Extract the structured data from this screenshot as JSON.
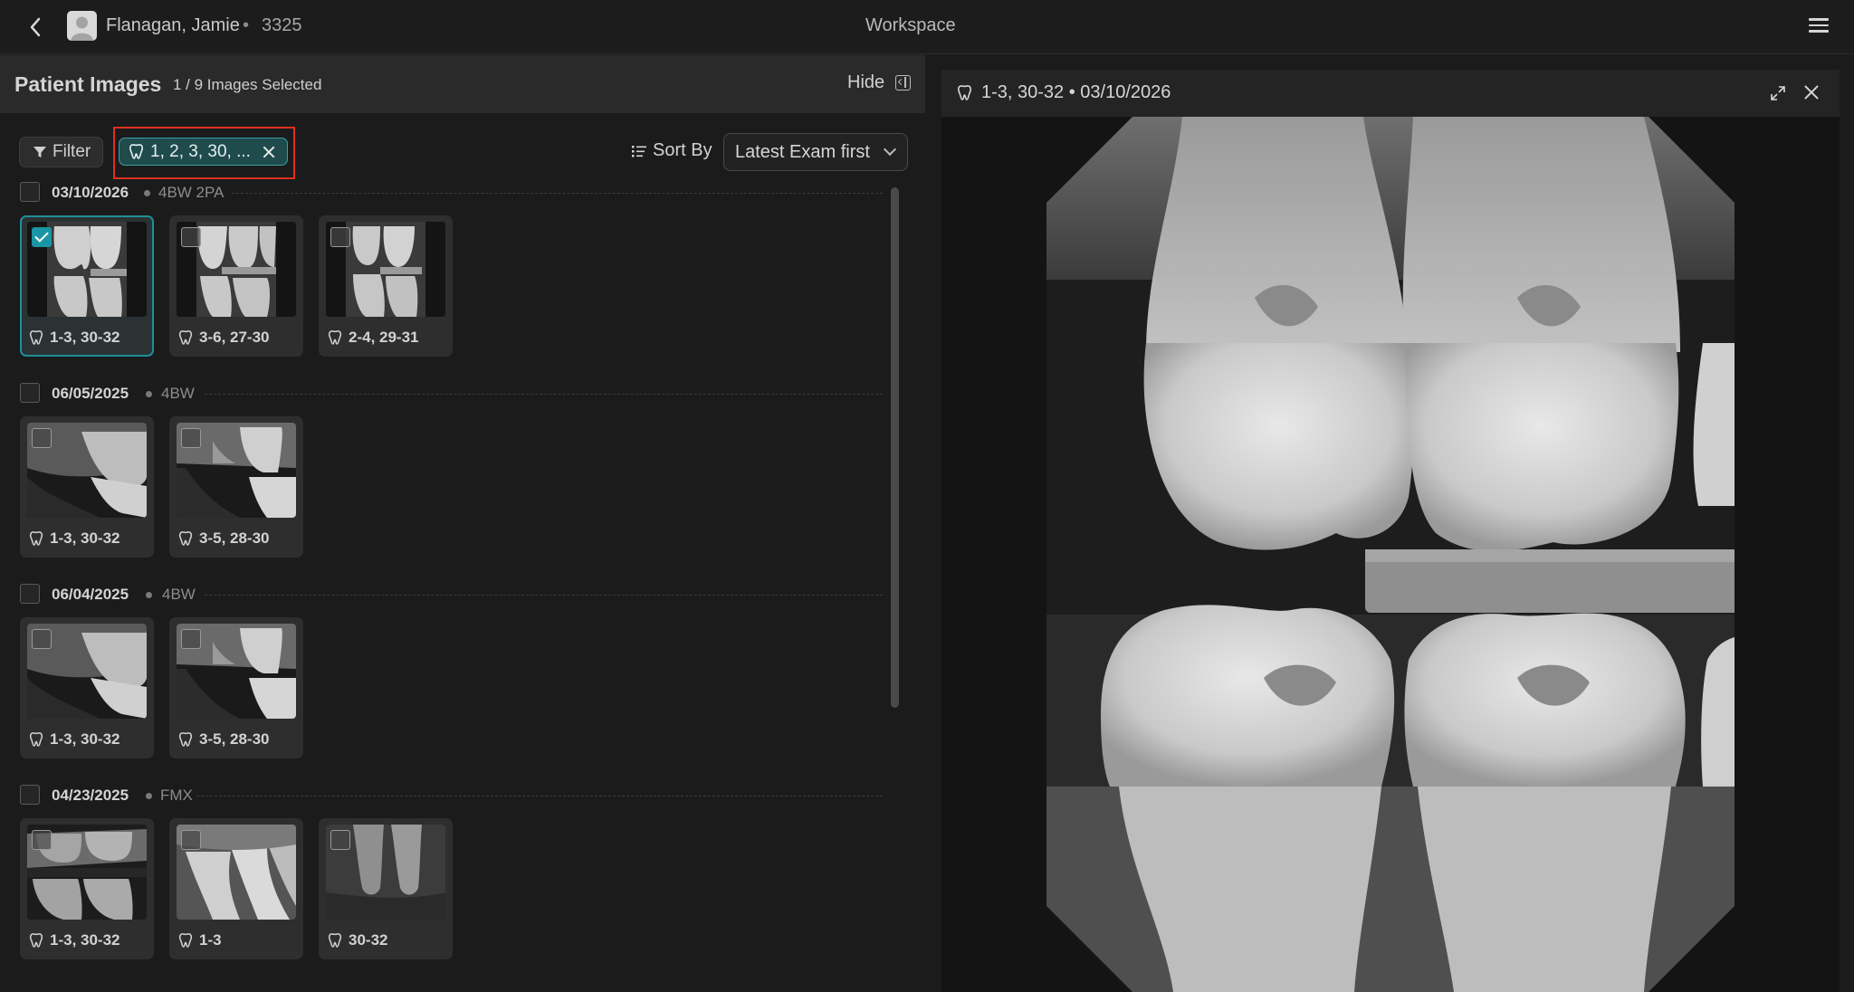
{
  "topbar": {
    "patient_name": "Flanagan, Jamie",
    "separator": "•",
    "patient_id": "3325",
    "app_title": "Workspace"
  },
  "left_panel": {
    "title": "Patient Images",
    "selection_count": "1 / 9 Images Selected",
    "hide_label": "Hide",
    "filter_label": "Filter",
    "active_filter_chip": "1, 2, 3, 30, ...",
    "sort_label": "Sort By",
    "sort_value": "Latest Exam first"
  },
  "groups": [
    {
      "date": "03/10/2026",
      "type": "4BW 2PA",
      "images": [
        {
          "label": "1-3, 30-32",
          "selected": true
        },
        {
          "label": "3-6, 27-30",
          "selected": false
        },
        {
          "label": "2-4, 29-31",
          "selected": false
        }
      ]
    },
    {
      "date": "06/05/2025",
      "type": "4BW",
      "images": [
        {
          "label": "1-3, 30-32",
          "selected": false
        },
        {
          "label": "3-5, 28-30",
          "selected": false
        }
      ]
    },
    {
      "date": "06/04/2025",
      "type": "4BW",
      "images": [
        {
          "label": "1-3, 30-32",
          "selected": false
        },
        {
          "label": "3-5, 28-30",
          "selected": false
        }
      ]
    },
    {
      "date": "04/23/2025",
      "type": "FMX",
      "images": [
        {
          "label": "1-3, 30-32",
          "selected": false
        },
        {
          "label": "1-3",
          "selected": false
        },
        {
          "label": "30-32",
          "selected": false
        }
      ]
    }
  ],
  "viewer": {
    "title": "1-3, 30-32 • 03/10/2026"
  },
  "colors": {
    "accent_teal": "#1a95a3",
    "highlight_red": "#e0301e",
    "background": "#1b1b1b"
  }
}
